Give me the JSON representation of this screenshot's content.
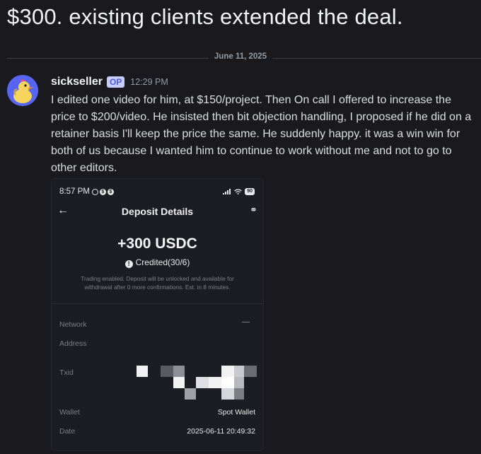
{
  "post": {
    "title": "$300. existing clients extended the deal."
  },
  "divider": {
    "date": "June 11, 2025"
  },
  "message": {
    "username": "sickseller",
    "badge": "OP",
    "timestamp": "12:29 PM",
    "body": "I edited one video for him, at $150/project. Then On call I offered to increase the price to $200/video. He insisted then bit objection handling, I proposed if he did on a retainer basis I'll keep the price the same. He suddenly happy. it was a win win for both of us because I wanted him to continue to work without me and not to go to other editors."
  },
  "screenshot": {
    "status_time": "8:57 PM",
    "battery": "90",
    "header_title": "Deposit Details",
    "amount": "+300 USDC",
    "status": "Credited(30/6)",
    "note": "Trading enabled. Deposit will be unlocked and available for withdrawal after 0 more confirmations. Est. in 8 minutes.",
    "rows": {
      "network_label": "Network",
      "address_label": "Address",
      "txid_label": "Txid",
      "wallet_label": "Wallet",
      "wallet_value": "Spot Wallet",
      "date_label": "Date",
      "date_value": "2025-06-11 20:49:32"
    }
  },
  "icons": {
    "avatar": "duck-avatar-icon",
    "back": "back-arrow-icon",
    "support": "headset-icon",
    "alarm": "alarm-icon",
    "info": "info-icon"
  },
  "colors": {
    "background": "#1a1a1e",
    "accent_badge": "#c9cdfb",
    "avatar_bg": "#5865f2"
  }
}
